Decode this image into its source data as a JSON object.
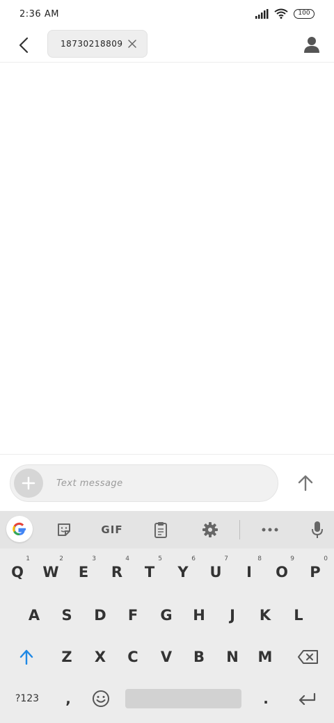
{
  "status": {
    "time": "2:36 AM",
    "battery": "100"
  },
  "header": {
    "recipient": "18730218809"
  },
  "compose": {
    "placeholder": "Text message"
  },
  "keyboard": {
    "toolbar": {
      "gif_label": "GIF"
    },
    "row1": [
      {
        "label": "Q",
        "hint": "1"
      },
      {
        "label": "W",
        "hint": "2"
      },
      {
        "label": "E",
        "hint": "3"
      },
      {
        "label": "R",
        "hint": "4"
      },
      {
        "label": "T",
        "hint": "5"
      },
      {
        "label": "Y",
        "hint": "6"
      },
      {
        "label": "U",
        "hint": "7"
      },
      {
        "label": "I",
        "hint": "8"
      },
      {
        "label": "O",
        "hint": "9"
      },
      {
        "label": "P",
        "hint": "0"
      }
    ],
    "row2": [
      "A",
      "S",
      "D",
      "F",
      "G",
      "H",
      "J",
      "K",
      "L"
    ],
    "row3": [
      "Z",
      "X",
      "C",
      "V",
      "B",
      "N",
      "M"
    ],
    "row4": {
      "symbols": "?123",
      "comma": ",",
      "period": "."
    }
  },
  "icons": {
    "back": "chevron-left-icon",
    "chip_close": "close-icon",
    "contact": "person-icon",
    "add": "plus-icon",
    "send": "arrow-up-icon",
    "google": "google-icon",
    "sticker": "sticker-icon",
    "clipboard": "clipboard-icon",
    "settings": "gear-icon",
    "more": "more-horizontal-icon",
    "mic": "microphone-icon",
    "shift": "shift-icon",
    "backspace": "backspace-icon",
    "emoji": "emoji-icon",
    "enter": "enter-icon"
  },
  "colors": {
    "shift_accent": "#1e88e5",
    "keyboard_bg": "#ececec",
    "toolbar_bg": "#e4e4e4"
  }
}
